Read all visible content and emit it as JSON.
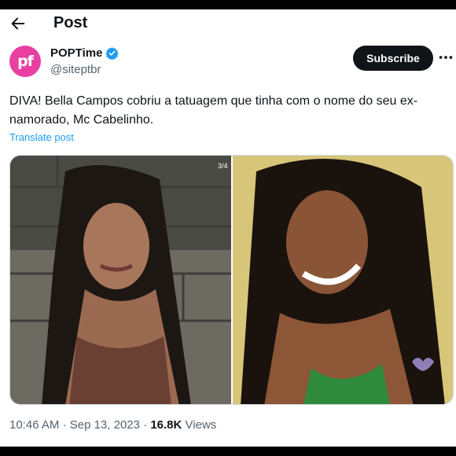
{
  "header": {
    "title": "Post"
  },
  "author": {
    "avatar_text": "pf",
    "name": "POPTime",
    "handle": "@siteptbr",
    "verified": true
  },
  "actions": {
    "subscribe_label": "Subscribe"
  },
  "post": {
    "text": "DIVA! Bella Campos cobriu a tatuagem que tinha com o nome do seu ex-namorado, Mc Cabelinho.",
    "translate_label": "Translate post",
    "image_counter": "3/4"
  },
  "meta": {
    "time": "10:46 AM",
    "date": "Sep 13, 2023",
    "views_count": "16.8K",
    "views_label": "Views"
  },
  "colors": {
    "accent": "#1d9bf0",
    "brand": "#e93fa3",
    "text": "#0f1419",
    "muted": "#536471"
  }
}
